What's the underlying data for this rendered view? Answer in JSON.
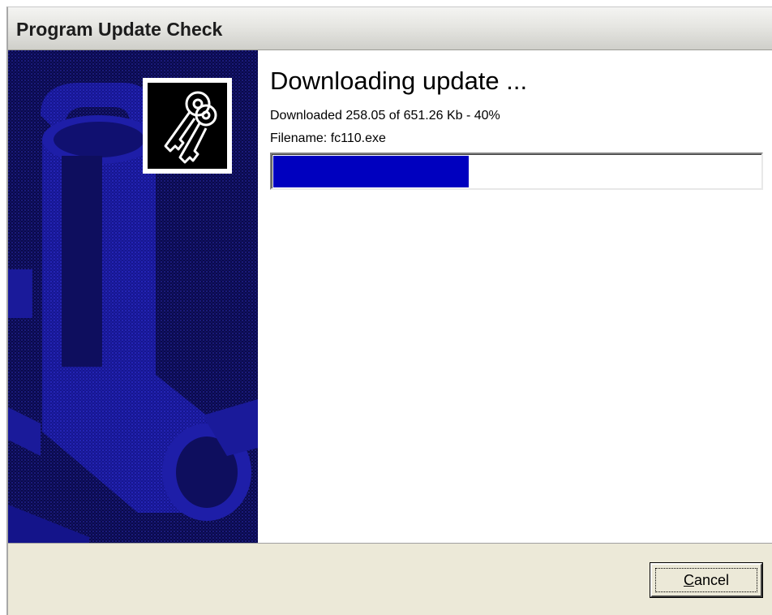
{
  "window": {
    "title": "Program Update Check"
  },
  "main": {
    "heading": "Downloading update ...",
    "status": "Downloaded 258.05 of 651.26 Kb - 40%",
    "filename_line": "Filename: fc110.exe",
    "progress_fraction": 0.4
  },
  "footer": {
    "cancel_label_mnemonic": "C",
    "cancel_label_rest": "ancel"
  },
  "icons": {
    "banner": "pipes-banner-graphic",
    "keys": "keys-icon"
  },
  "colors": {
    "banner_background": "#0a0a4a",
    "progress_fill": "#0000bf",
    "dialog_face": "#ece9d8"
  }
}
